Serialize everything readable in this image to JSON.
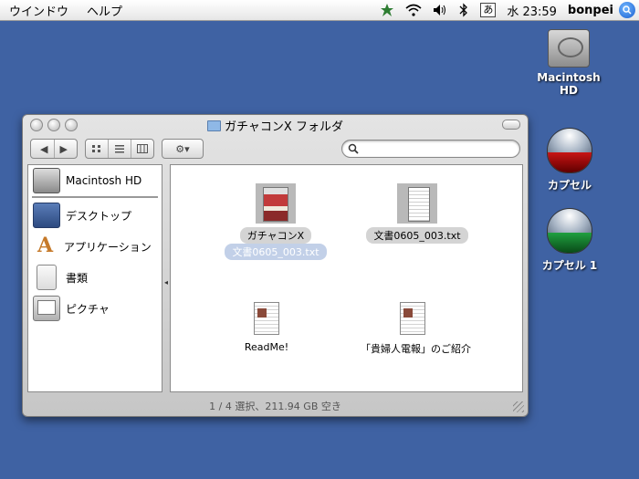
{
  "menubar": {
    "items": [
      "ウインドウ",
      "ヘルプ"
    ],
    "clock": "水 23:59",
    "ime": "あ",
    "user": "bonpei"
  },
  "desktop": {
    "hd_label": "Macintosh HD",
    "capsule1_label": "カプセル",
    "capsule2_label": "カプセル 1"
  },
  "window": {
    "title": "ガチャコンX フォルダ",
    "search_placeholder": "",
    "status": "1 / 4 選択、211.94 GB 空き"
  },
  "sidebar": {
    "items": [
      {
        "label": "Macintosh HD",
        "icon": "hard-disk-icon"
      },
      {
        "label": "デスクトップ",
        "icon": "desktop-icon"
      },
      {
        "label": "アプリケーション",
        "icon": "applications-icon"
      },
      {
        "label": "書類",
        "icon": "documents-icon"
      },
      {
        "label": "ピクチャ",
        "icon": "pictures-icon"
      }
    ]
  },
  "files": [
    {
      "name": "ガチャコンX",
      "rename": "文書0605_003.txt"
    },
    {
      "name": "文書0605_003.txt"
    },
    {
      "name": "ReadMe!"
    },
    {
      "name": "「貴婦人電報」のご紹介"
    }
  ],
  "colors": {
    "desktop": "#3f62a3",
    "selection": "#c2d0e8"
  }
}
